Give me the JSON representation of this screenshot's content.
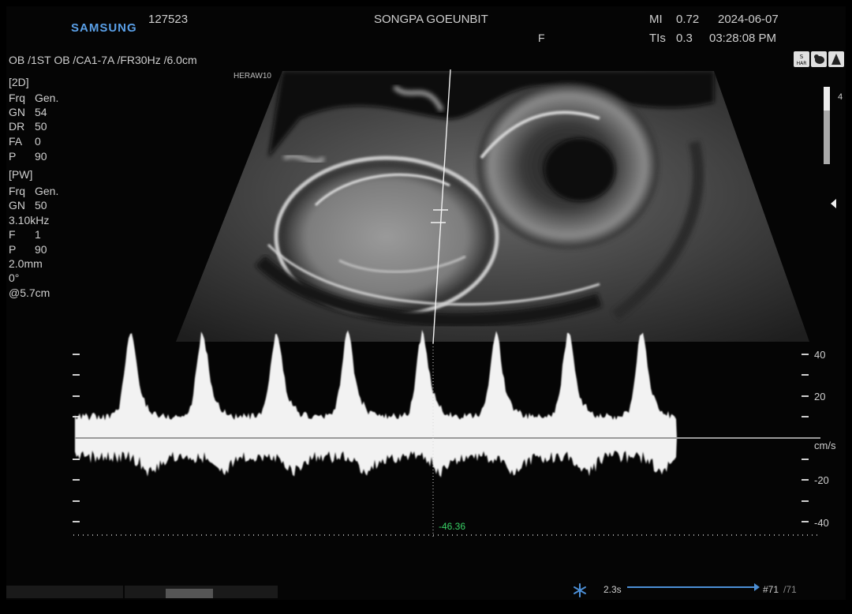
{
  "header": {
    "brand": "SAMSUNG",
    "patient_id": "127523",
    "institution": "SONGPA GOEUNBIT",
    "sex": "F",
    "mi_label": "MI",
    "mi_value": "0.72",
    "tis_label": "TIs",
    "tis_value": "0.3",
    "date": "2024-06-07",
    "time": "03:28:08 PM"
  },
  "preset_line": "OB /1ST OB /CA1-7A /FR30Hz /6.0cm",
  "image_label": "HERAW10",
  "params_2d": {
    "title": "[2D]",
    "rows": [
      {
        "k": "Frq",
        "v": "Gen."
      },
      {
        "k": "GN",
        "v": "54"
      },
      {
        "k": "DR",
        "v": "50"
      },
      {
        "k": "FA",
        "v": "0"
      },
      {
        "k": "P",
        "v": "90"
      }
    ]
  },
  "params_pw": {
    "title": "[PW]",
    "rows": [
      {
        "k": "Frq",
        "v": "Gen."
      },
      {
        "k": "GN",
        "v": "50"
      },
      {
        "k": "3.10kHz",
        "v": ""
      },
      {
        "k": "F",
        "v": "1"
      },
      {
        "k": "P",
        "v": "90"
      },
      {
        "k": " 2.0mm",
        "v": ""
      },
      {
        "k": "0°",
        "v": ""
      },
      {
        "k": "@5.7cm",
        "v": ""
      }
    ]
  },
  "gray_scale_tick": "4",
  "doppler": {
    "scale_labels": [
      "40",
      "20",
      "-20",
      "-40"
    ],
    "unit": "cm/s",
    "cursor_velocity": "-46.36"
  },
  "cine": {
    "duration": "2.3s",
    "frame": "#71",
    "total": "/71"
  },
  "icons": [
    "sh-har-icon",
    "fetus-icon",
    "probe-icon",
    "freeze-snowflake-icon"
  ],
  "colors": {
    "brand": "#5aa0e8",
    "velocity_readout": "#39d266",
    "cine_bar": "#4c8fd6"
  }
}
